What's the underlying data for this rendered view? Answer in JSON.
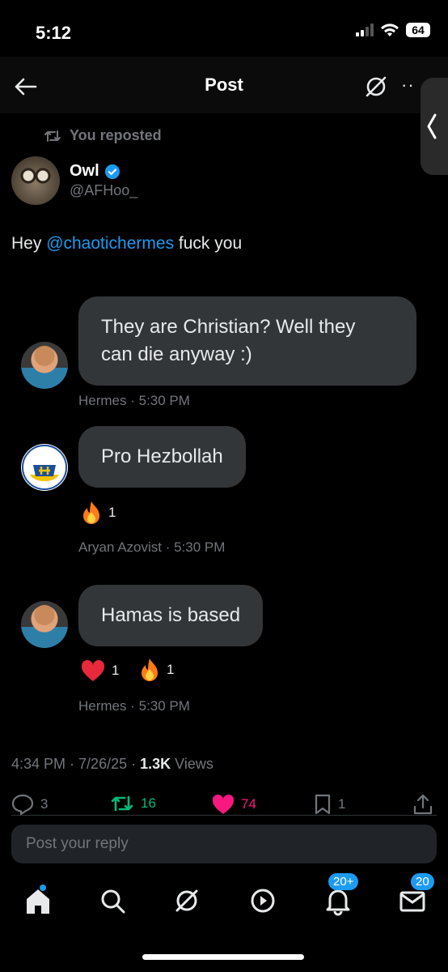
{
  "status_bar": {
    "time": "5:12",
    "battery": "64"
  },
  "nav": {
    "title": "Post",
    "more": "··"
  },
  "repost": {
    "label": "You reposted"
  },
  "author": {
    "name": "Owl",
    "handle": "@AFHoo_"
  },
  "post": {
    "text_before": "Hey ",
    "mention": "@chaotichermes",
    "text_after": " fuck you"
  },
  "messages": [
    {
      "avatar": "hermes-avatar",
      "text_line1": "They are Christian? Well they",
      "text_line2": "can die anyway :)",
      "sender": "Hermes",
      "time": "5:30 PM"
    },
    {
      "avatar": "azov-avatar",
      "text": "Pro Hezbollah",
      "sender": "Aryan Azovist",
      "time": "5:30 PM",
      "reactions": [
        {
          "icon": "fire-icon",
          "count": "1"
        }
      ]
    },
    {
      "avatar": "hermes-avatar",
      "text": "Hamas is based",
      "sender": "Hermes",
      "time": "5:30 PM",
      "reactions": [
        {
          "icon": "heart-icon",
          "count": "1"
        },
        {
          "icon": "fire-icon",
          "count": "1"
        }
      ]
    }
  ],
  "stats": {
    "time": "4:34 PM",
    "date": "7/26/25",
    "views_count": "1.3K",
    "views_label": "Views",
    "sep": " · "
  },
  "actions": {
    "replies": "3",
    "reposts": "16",
    "likes": "74",
    "bookmarks": "1"
  },
  "reply": {
    "placeholder": "Post your reply"
  },
  "tabbar": {
    "notifications_badge": "20+",
    "messages_badge": "20"
  },
  "colors": {
    "accent": "#1d9bf0",
    "like": "#f91880",
    "repost": "#00ba7c",
    "bubble": "#333639"
  }
}
